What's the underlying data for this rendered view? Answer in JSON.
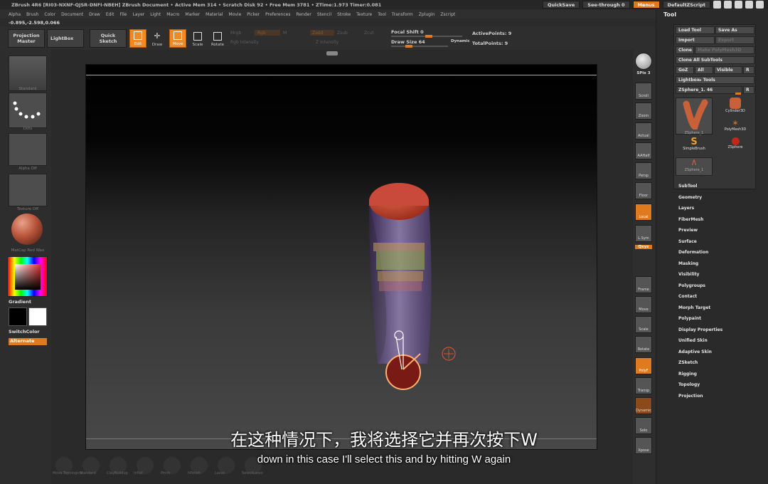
{
  "titlebar": {
    "text": "ZBrush 4R6 [RI03-NXNF-QJSR-DNFI-NBEH]    ZBrush Document    • Active Mem 314 • Scratch Disk 92 • Free Mem 3781 • ZTime:1.973 Timer:0.081",
    "quicksave": "QuickSave",
    "seethrough": "See-through  0",
    "menus": "Menus",
    "script": "DefaultZScript"
  },
  "menubar": [
    "Alpha",
    "Brush",
    "Color",
    "Document",
    "Draw",
    "Edit",
    "File",
    "Layer",
    "Light",
    "Macro",
    "Marker",
    "Material",
    "Movie",
    "Picker",
    "Preferences",
    "Render",
    "Stencil",
    "Stroke",
    "Texture",
    "Tool",
    "Transform",
    "Zplugin",
    "Zscript"
  ],
  "coords": "-0.895,-2.598,0.066",
  "toolbar": {
    "projection_master": "Projection\nMaster",
    "lightbox": "LightBox",
    "quick_sketch": "Quick\nSketch",
    "edit": "Edit",
    "draw": "Draw",
    "move": "Move",
    "scale": "Scale",
    "rotate": "Rotate",
    "mrgb": "Mrgb",
    "rgb": "Rgb",
    "m": "M",
    "zadd": "Zadd",
    "zsub": "Zsub",
    "zcut": "Zcut",
    "rgb_intensity": "Rgb Intensity",
    "z_intensity": "Z Intensity",
    "focal_shift": "Focal Shift 0",
    "draw_size": "Draw Size 64",
    "dynamic": "Dynamic",
    "active_points": "ActivePoints: 9",
    "total_points": "TotalPoints: 9"
  },
  "leftshelf": {
    "brush_lbl": "Standard",
    "stroke_lbl": "Dots",
    "alpha_lbl": "Alpha Off",
    "texture_lbl": "Texture Off",
    "material_lbl": "MatCap Red Wax",
    "gradient": "Gradient",
    "switchcolor": "SwitchColor",
    "alternate": "Alternate"
  },
  "rightshelf": {
    "bpr": "BPR",
    "spix": "SPix 3",
    "scroll": "Scroll",
    "zoom": "Zoom",
    "actual": "Actual",
    "aahalf": "AAHalf",
    "persp": "Persp",
    "floor": "Floor",
    "local": "Local",
    "lsym": "L.Sym",
    "xyz": "Qxyz",
    "frame": "Frame",
    "move": "Move",
    "scale": "Scale",
    "rotate": "Rotate",
    "polyf": "PolyF",
    "transp": "Transp",
    "dynamic": "Dynamic",
    "solo": "Solo",
    "xpose": "Xpose"
  },
  "toolpanel": {
    "header": "Tool",
    "load_tool": "Load Tool",
    "save_as": "Save As",
    "import": "Import",
    "export": "Export",
    "clone": "Clone",
    "make_polymesh": "Make PolyMesh3D",
    "clone_all": "Clone All SubTools",
    "goz": "GoZ",
    "all": "All",
    "visible": "Visible",
    "r": "R",
    "lightbox_tools": "Lightbox▸ Tools",
    "current_tool": "ZSphere_1. 46",
    "thumbs": [
      "ZSphere_1",
      "Cylinder3D",
      "PolyMesh3D",
      "SimpleBrush",
      "ZSphere",
      "ZSphere_1"
    ],
    "subpalettes": [
      "SubTool",
      "Geometry",
      "Layers",
      "FiberMesh",
      "Preview",
      "Surface",
      "Deformation",
      "Masking",
      "Visibility",
      "Polygroups",
      "Contact",
      "Morph Target",
      "Polypaint",
      "Display Properties",
      "Unified Skin",
      "Adaptive Skin",
      "ZSketch",
      "Rigging",
      "Topology",
      "Projection"
    ]
  },
  "subtitles": {
    "cn": "在这种情况下，我将选择它并再次按下W",
    "en": "down in this case I'll select this and by hitting W again"
  },
  "bottomshelf": [
    "Move Topological",
    "Standard",
    "ClayBuildup",
    "Inflat",
    "Pinch",
    "hPolish",
    "Lasso",
    "SelectLasso"
  ]
}
